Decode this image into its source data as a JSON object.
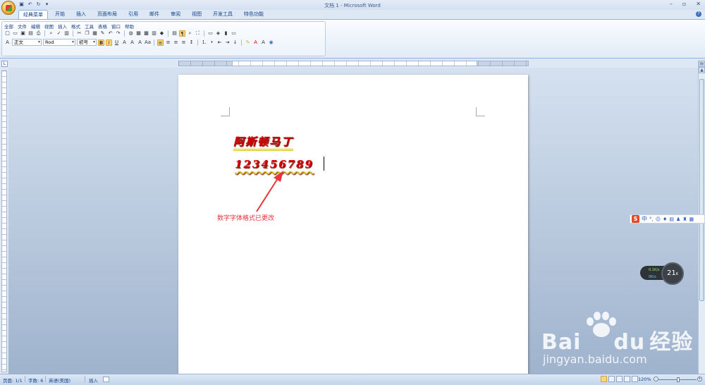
{
  "window": {
    "title": "文档 1 - Microsoft Word",
    "controls": [
      "–",
      "▫",
      "✕"
    ]
  },
  "qat_icons": [
    "save-icon",
    "undo-icon",
    "redo-icon",
    "customize-icon"
  ],
  "ribbon": {
    "tabs": [
      "经典菜单",
      "开始",
      "插入",
      "页面布局",
      "引用",
      "邮件",
      "审阅",
      "视图",
      "开发工具",
      "特色功能"
    ],
    "active_tab": "经典菜单",
    "menus": [
      "全部",
      "文件",
      "编辑",
      "视图",
      "插入",
      "格式",
      "工具",
      "表格",
      "窗口",
      "帮助"
    ],
    "style_value": "正文",
    "font_value": "Rod",
    "size_value": "初号"
  },
  "document": {
    "line1": "阿斯顿马丁",
    "line2": "123456789",
    "annotation": "数字字体格式已更改",
    "text_color": "#d90000",
    "underline_color": "#d4c400"
  },
  "ime": {
    "logo": "S",
    "mode": "中",
    "punct": "°,"
  },
  "network": {
    "up": "0.1K/s",
    "down": "0K/s",
    "gauge": "21",
    "gauge_unit": "K"
  },
  "watermark": {
    "brand": "Bai",
    "brand2": "du",
    "brand_cn": "经验",
    "url": "jingyan.baidu.com"
  },
  "status": {
    "page": "页面: 1/1",
    "words": "字数: 6",
    "language": "英语(美国)",
    "mode": "插入",
    "zoom": "120%"
  }
}
